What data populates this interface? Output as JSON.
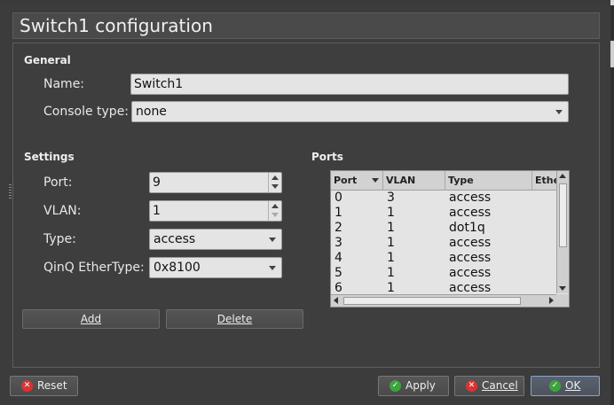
{
  "window": {
    "title": "Switch1 configuration"
  },
  "general": {
    "heading": "General",
    "name_label": "Name:",
    "name_value": "Switch1",
    "console_label": "Console type:",
    "console_value": "none"
  },
  "settings": {
    "heading": "Settings",
    "port_label": "Port:",
    "port_value": "9",
    "vlan_label": "VLAN:",
    "vlan_value": "1",
    "type_label": "Type:",
    "type_value": "access",
    "qinq_label": "QinQ EtherType:",
    "qinq_value": "0x8100",
    "add_label": "Add",
    "delete_label": "Delete"
  },
  "ports": {
    "heading": "Ports",
    "columns": [
      "Port",
      "VLAN",
      "Type",
      "Ethe"
    ],
    "rows": [
      {
        "port": "0",
        "vlan": "3",
        "type": "access"
      },
      {
        "port": "1",
        "vlan": "1",
        "type": "access"
      },
      {
        "port": "2",
        "vlan": "1",
        "type": "dot1q"
      },
      {
        "port": "3",
        "vlan": "1",
        "type": "access"
      },
      {
        "port": "4",
        "vlan": "1",
        "type": "access"
      },
      {
        "port": "5",
        "vlan": "1",
        "type": "access"
      },
      {
        "port": "6",
        "vlan": "1",
        "type": "access"
      }
    ]
  },
  "footer": {
    "reset_label": "Reset",
    "apply_label": "Apply",
    "cancel_label": "Cancel",
    "ok_label": "OK"
  },
  "colors": {
    "accent_green": "#3da33d",
    "accent_red": "#d73434",
    "background": "#3c3c3c"
  }
}
